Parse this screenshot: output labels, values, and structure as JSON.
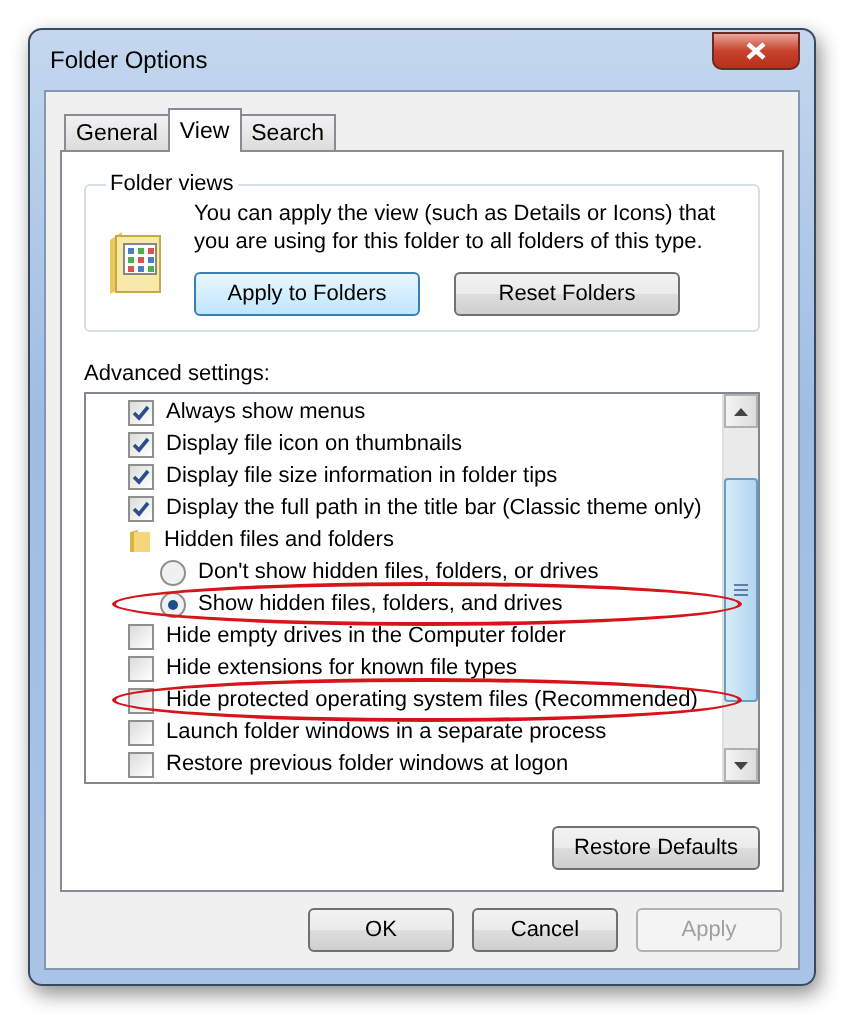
{
  "window": {
    "title": "Folder Options"
  },
  "tabs": [
    {
      "label": "General",
      "selected": false
    },
    {
      "label": "View",
      "selected": true
    },
    {
      "label": "Search",
      "selected": false
    }
  ],
  "folder_views": {
    "legend": "Folder views",
    "description": "You can apply the view (such as Details or Icons) that you are using for this folder to all folders of this type.",
    "buttons": [
      {
        "label": "Apply to Folders",
        "default": true
      },
      {
        "label": "Reset Folders",
        "default": false
      }
    ]
  },
  "advanced_settings": {
    "label": "Advanced settings:",
    "items": [
      {
        "kind": "checkbox",
        "label": "Always show menus",
        "checked": true,
        "highlighted": false
      },
      {
        "kind": "checkbox",
        "label": "Display file icon on thumbnails",
        "checked": true,
        "highlighted": false
      },
      {
        "kind": "checkbox",
        "label": "Display file size information in folder tips",
        "checked": true,
        "highlighted": false
      },
      {
        "kind": "checkbox",
        "label": "Display the full path in the title bar (Classic theme only)",
        "checked": true,
        "highlighted": false
      },
      {
        "kind": "folder",
        "label": "Hidden files and folders",
        "highlighted": false,
        "children": [
          {
            "kind": "radio",
            "label": "Don't show hidden files, folders, or drives",
            "selected": false,
            "highlighted": false
          },
          {
            "kind": "radio",
            "label": "Show hidden files, folders, and drives",
            "selected": true,
            "highlighted": true
          }
        ]
      },
      {
        "kind": "checkbox",
        "label": "Hide empty drives in the Computer folder",
        "checked": false,
        "highlighted": false
      },
      {
        "kind": "checkbox",
        "label": "Hide extensions for known file types",
        "checked": false,
        "highlighted": false
      },
      {
        "kind": "checkbox",
        "label": "Hide protected operating system files (Recommended)",
        "checked": false,
        "highlighted": true
      },
      {
        "kind": "checkbox",
        "label": "Launch folder windows in a separate process",
        "checked": false,
        "highlighted": false
      },
      {
        "kind": "checkbox",
        "label": "Restore previous folder windows at logon",
        "checked": false,
        "highlighted": false
      }
    ],
    "restore_button": "Restore Defaults"
  },
  "buttons": [
    {
      "label": "OK",
      "disabled": false
    },
    {
      "label": "Cancel",
      "disabled": false
    },
    {
      "label": "Apply",
      "disabled": true
    }
  ]
}
